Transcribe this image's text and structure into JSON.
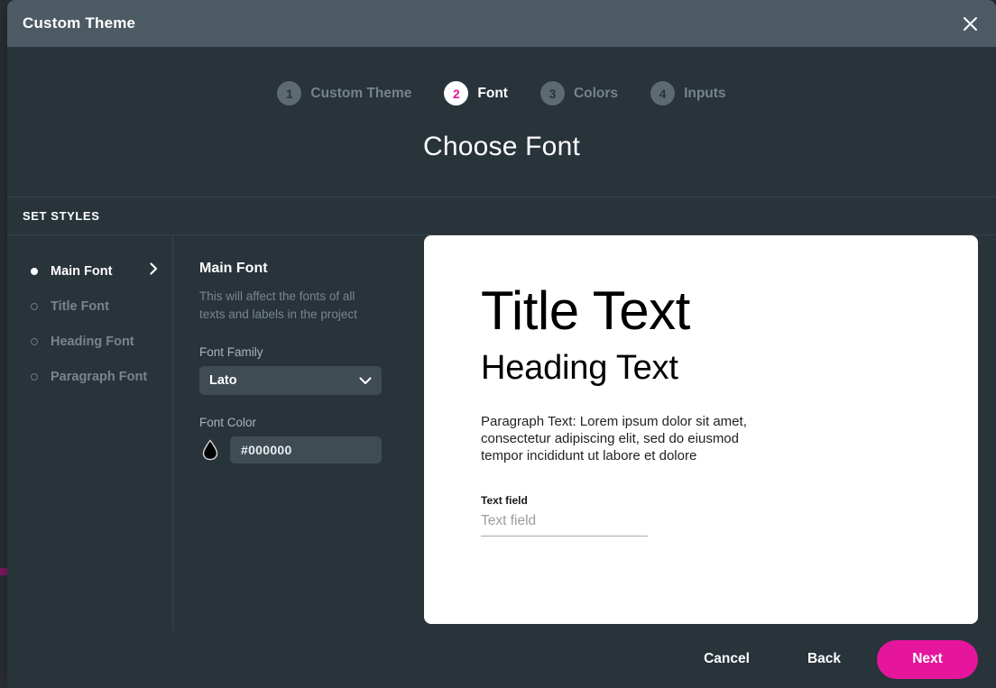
{
  "window": {
    "title": "Custom Theme",
    "close_icon": "close-icon"
  },
  "stepper": {
    "steps": [
      {
        "num": "1",
        "label": "Custom Theme",
        "active": false
      },
      {
        "num": "2",
        "label": "Font",
        "active": true
      },
      {
        "num": "3",
        "label": "Colors",
        "active": false
      },
      {
        "num": "4",
        "label": "Inputs",
        "active": false
      }
    ]
  },
  "header": {
    "page_title": "Choose Font"
  },
  "section": {
    "set_styles_label": "SET STYLES"
  },
  "sidebar": {
    "items": [
      {
        "label": "Main Font",
        "active": true
      },
      {
        "label": "Title Font",
        "active": false
      },
      {
        "label": "Heading Font",
        "active": false
      },
      {
        "label": "Paragraph Font",
        "active": false
      }
    ],
    "chevron_icon": "chevron-right-icon"
  },
  "form": {
    "heading": "Main Font",
    "description": "This will affect the fonts of all texts and labels in the project",
    "font_family_label": "Font Family",
    "font_family_value": "Lato",
    "font_family_chevron_icon": "chevron-down-icon",
    "font_color_label": "Font Color",
    "font_color_value": "#000000",
    "color_swatch_icon": "droplet-icon"
  },
  "preview": {
    "title": "Title Text",
    "heading": "Heading Text",
    "paragraph": "Paragraph Text: Lorem ipsum dolor sit amet, consectetur adipiscing elit, sed do eiusmod tempor incididunt ut labore et dolore",
    "field_label": "Text field",
    "field_placeholder": "Text field"
  },
  "footer": {
    "cancel_label": "Cancel",
    "back_label": "Back",
    "next_label": "Next"
  },
  "colors": {
    "accent": "#e5169b",
    "titlebar": "#4c5b63",
    "body": "#28333a",
    "input": "#3f4c54",
    "muted_text": "#79868e"
  }
}
